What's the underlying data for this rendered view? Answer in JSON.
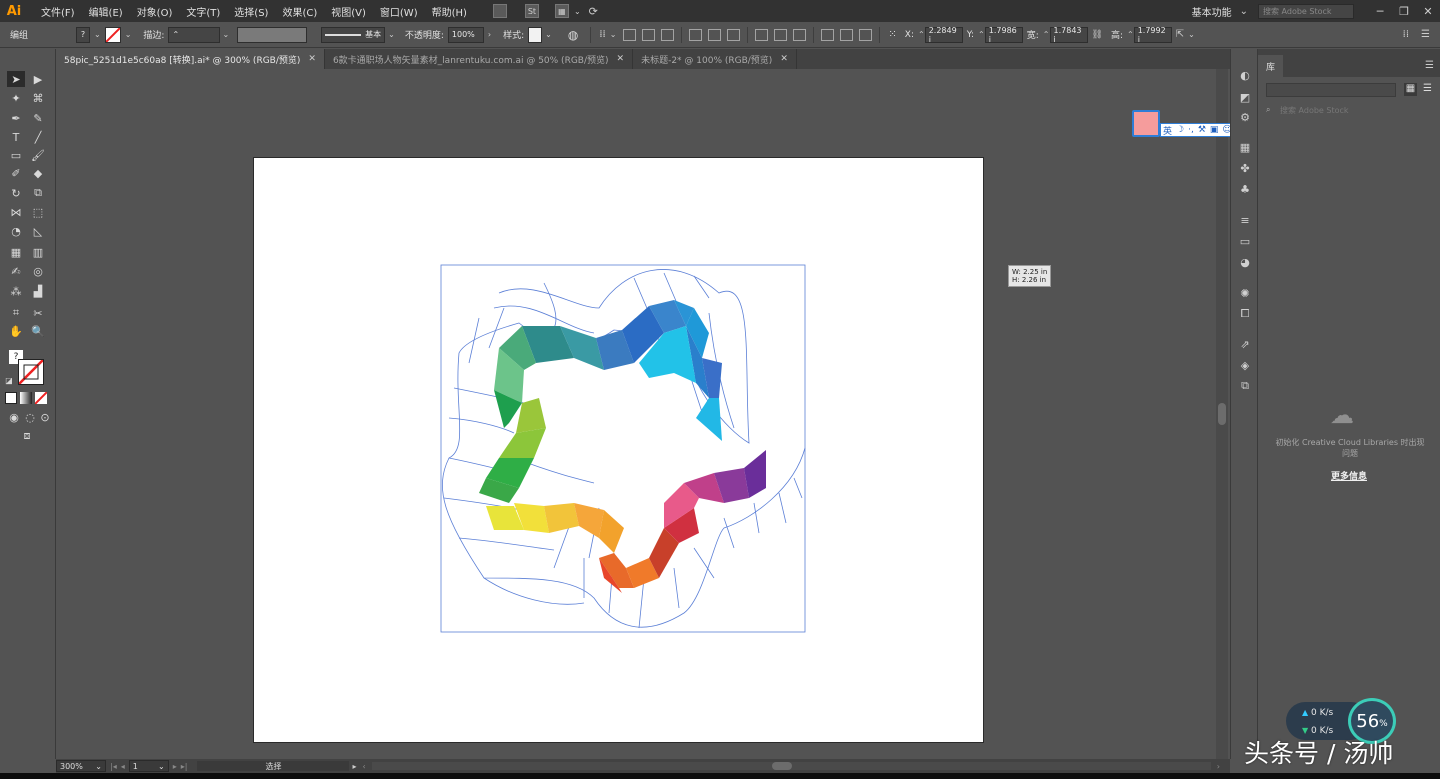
{
  "app": {
    "logo": "Ai"
  },
  "menu": [
    "文件(F)",
    "编辑(E)",
    "对象(O)",
    "文字(T)",
    "选择(S)",
    "效果(C)",
    "视图(V)",
    "窗口(W)",
    "帮助(H)"
  ],
  "menubar_right": {
    "workspace": "基本功能",
    "stock_search_placeholder": "搜索 Adobe Stock",
    "window_buttons": [
      "─",
      "❐",
      "✕"
    ]
  },
  "control": {
    "mode_label": "编组",
    "stroke_label": "描边:",
    "stroke_style": "基本",
    "opacity_label": "不透明度:",
    "opacity_value": "100%",
    "style_label": "样式:",
    "x_label": "X:",
    "x_value": "2.2849 i",
    "y_label": "Y:",
    "y_value": "1.7986 i",
    "w_label": "宽:",
    "w_value": "1.7843 i",
    "h_label": "高:",
    "h_value": "1.7992 i"
  },
  "tabs": [
    {
      "label": "58pic_5251d1e5c60a8 [转换].ai* @ 300% (RGB/预览)",
      "active": true
    },
    {
      "label": "6款卡通职场人物矢量素材_lanrentuku.com.ai @ 50% (RGB/预览)",
      "active": false
    },
    {
      "label": "未标题-2* @ 100% (RGB/预览)",
      "active": false
    }
  ],
  "dimension_tooltip": {
    "w": "W: 2.25 in",
    "h": "H: 2.26 in"
  },
  "ime": {
    "lang": "英"
  },
  "library": {
    "tab": "库",
    "search_placeholder": "搜索 Adobe Stock",
    "message": "初始化 Creative Cloud Libraries 时出现问题",
    "link": "更多信息"
  },
  "status": {
    "zoom": "300%",
    "page": "1",
    "tool": "选择"
  },
  "net": {
    "up": "0 K/s",
    "down": "0 K/s",
    "percent": "56",
    "percent_unit": "%"
  },
  "watermark": "头条号 / 汤帅",
  "colors": {
    "star_gradient": [
      "#2e8b8b",
      "#2b6cc4",
      "#1e9fd8",
      "#22c2e8",
      "#6a2e9a",
      "#c0408a",
      "#e8462a",
      "#f2a22c",
      "#f2e03a",
      "#9ac63a",
      "#2fae46",
      "#6cc48a"
    ],
    "guide_line": "#5b7fd6"
  }
}
